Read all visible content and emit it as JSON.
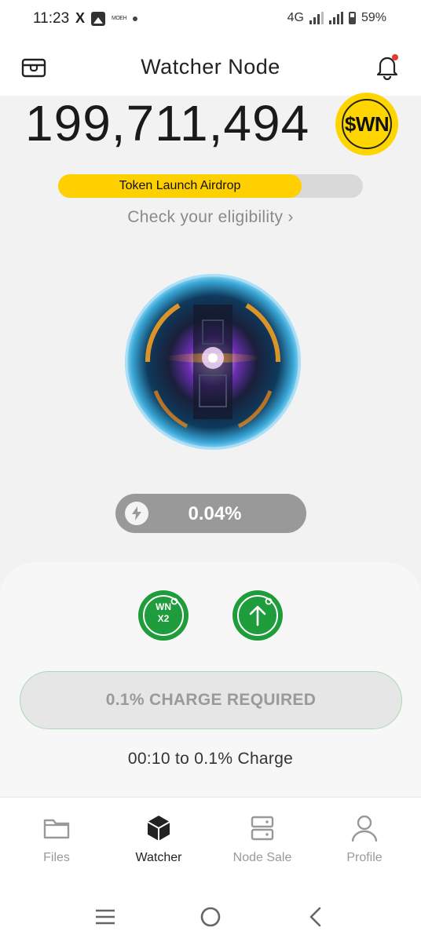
{
  "status_bar": {
    "time": "11:23",
    "x_icon": "X",
    "mini_text": "MOEH",
    "network": "4G",
    "battery": "59%"
  },
  "header": {
    "title": "Watcher Node",
    "left_icon": "wallet-icon",
    "right_icon": "bell-icon",
    "notification_dot_color": "#e53935"
  },
  "balance": {
    "value": "199,711,494",
    "token_badge": "$WN"
  },
  "airdrop": {
    "label": "Token Launch Airdrop",
    "progress_percent": 80,
    "accent": "#ffd000"
  },
  "eligibility_link": "Check your eligibility ›",
  "charge": {
    "value": "0.04%",
    "icon": "bolt-icon"
  },
  "actions": {
    "boost_line1": "WN",
    "boost_line2": "X2",
    "upgrade_icon": "arrow-up-icon",
    "accent": "#1f9d3c"
  },
  "charge_button": {
    "label": "0.1% CHARGE REQUIRED"
  },
  "countdown": "00:10 to 0.1% Charge",
  "nav": {
    "items": [
      {
        "label": "Files",
        "icon": "folder-icon"
      },
      {
        "label": "Watcher",
        "icon": "cube-icon"
      },
      {
        "label": "Node Sale",
        "icon": "server-icon"
      },
      {
        "label": "Profile",
        "icon": "user-icon"
      }
    ],
    "active": "Watcher"
  },
  "system_nav": [
    "menu-icon",
    "home-icon",
    "back-icon"
  ]
}
